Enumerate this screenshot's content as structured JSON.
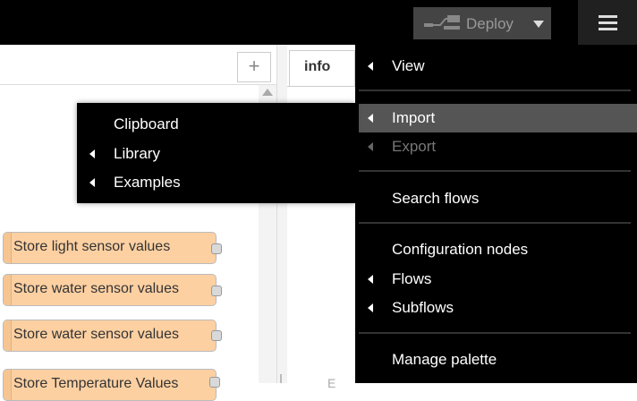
{
  "header": {
    "deploy_label": "Deploy",
    "colors": {
      "bar": "#000000",
      "deploy_bg": "#444444",
      "menu_btn_bg": "#202020"
    }
  },
  "workspace": {
    "add_tab_label": "+",
    "nodes": [
      {
        "label": "Store light sensor values"
      },
      {
        "label": "Store water sensor values"
      },
      {
        "label": "Store water sensor values"
      },
      {
        "label": "Store Temperature Values"
      }
    ],
    "node_color": "#fdd0a2"
  },
  "sidebar": {
    "tab_label": "info",
    "peek_label": "E"
  },
  "menu": {
    "view": "View",
    "import": "Import",
    "export": "Export",
    "search_flows": "Search flows",
    "configuration_nodes": "Configuration nodes",
    "flows": "Flows",
    "subflows": "Subflows",
    "manage_palette": "Manage palette"
  },
  "submenu": {
    "clipboard": "Clipboard",
    "library": "Library",
    "examples": "Examples"
  },
  "icons": {
    "deploy": "deploy-flow-icon",
    "caret_down": "caret-down-icon",
    "menu": "hamburger-menu-icon",
    "caret_left": "caret-left-icon",
    "scroll_up": "scroll-up-arrow-icon"
  }
}
